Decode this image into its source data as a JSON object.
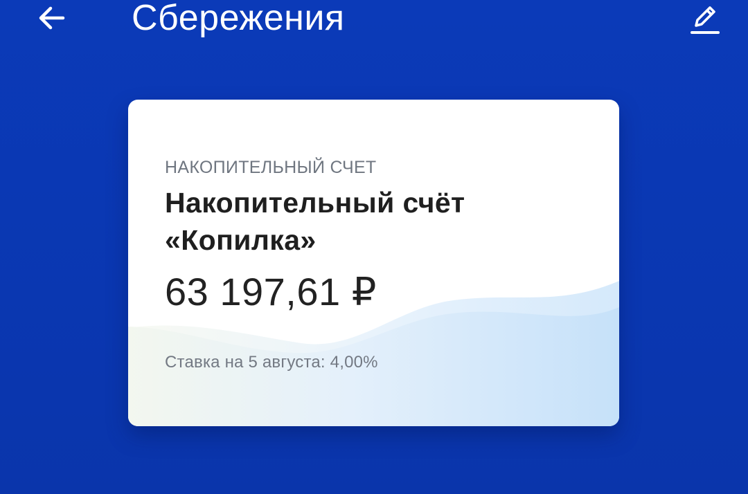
{
  "header": {
    "title": "Сбережения",
    "back_icon": "arrow-left-icon",
    "edit_icon": "pencil-icon"
  },
  "account_card": {
    "type_label": "НАКОПИТЕЛЬНЫЙ СЧЕТ",
    "name_line1": "Накопительный счёт",
    "name_line2": "«Копилка»",
    "balance": "63 197,61 ₽",
    "rate": "Ставка на 5 августа: 4,00%"
  },
  "colors": {
    "background": "#0a38b4",
    "card": "#ffffff",
    "wave": "#c9e2fa",
    "title_text": "#ffffff",
    "secondary_text": "#6f7680"
  }
}
